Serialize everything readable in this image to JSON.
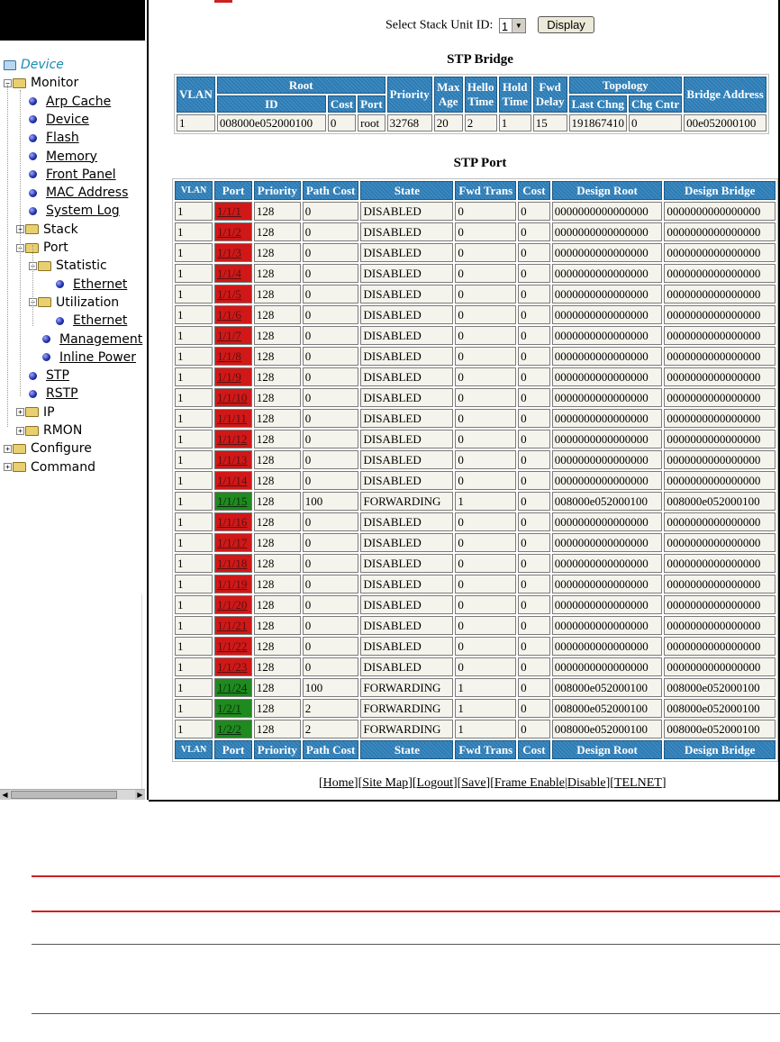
{
  "nav": {
    "tree": [
      {
        "label": "Device",
        "kind": "root"
      },
      {
        "label": "Monitor",
        "kind": "folder-open"
      },
      {
        "label": "Arp Cache",
        "kind": "link"
      },
      {
        "label": "Device",
        "kind": "link"
      },
      {
        "label": "Flash",
        "kind": "link"
      },
      {
        "label": "Memory",
        "kind": "link"
      },
      {
        "label": "Front Panel",
        "kind": "link"
      },
      {
        "label": "MAC Address",
        "kind": "link"
      },
      {
        "label": "System Log",
        "kind": "link"
      },
      {
        "label": "Stack",
        "kind": "folder-closed"
      },
      {
        "label": "Port",
        "kind": "folder-open"
      },
      {
        "label": "Statistic",
        "kind": "folder-open"
      },
      {
        "label": "Ethernet",
        "kind": "link"
      },
      {
        "label": "Utilization",
        "kind": "folder-open"
      },
      {
        "label": "Ethernet",
        "kind": "link"
      },
      {
        "label": "Management",
        "kind": "link"
      },
      {
        "label": "Inline Power",
        "kind": "link"
      },
      {
        "label": "STP",
        "kind": "link"
      },
      {
        "label": "RSTP",
        "kind": "link"
      },
      {
        "label": "IP",
        "kind": "folder-closed"
      },
      {
        "label": "RMON",
        "kind": "folder-closed"
      },
      {
        "label": "Configure",
        "kind": "folder-closed"
      },
      {
        "label": "Command",
        "kind": "folder-closed"
      }
    ]
  },
  "stack_select": {
    "label": "Select Stack Unit ID:",
    "value": "1",
    "button": "Display"
  },
  "stp_bridge": {
    "title": "STP Bridge",
    "group_headers": {
      "root": "Root",
      "topology": "Topology"
    },
    "headers": {
      "vlan": "VLAN",
      "id": "ID",
      "cost": "Cost",
      "port": "Port",
      "priority": "Priority",
      "max_age": "Max Age",
      "hello_time": "Hello Time",
      "hold_time": "Hold Time",
      "fwd_delay": "Fwd Delay",
      "last_chng": "Last Chng",
      "chg_cntr": "Chg Cntr",
      "bridge_address": "Bridge Address"
    },
    "row": {
      "vlan": "1",
      "id": "008000e052000100",
      "cost": "0",
      "port": "root",
      "priority": "32768",
      "max_age": "20",
      "hello_time": "2",
      "hold_time": "1",
      "fwd_delay": "15",
      "last_chng": "191867410",
      "chg_cntr": "0",
      "bridge_address": "00e052000100"
    }
  },
  "stp_port": {
    "title": "STP Port",
    "headers": [
      "VLAN",
      "Port",
      "Priority",
      "Path Cost",
      "State",
      "Fwd Trans",
      "Cost",
      "Design Root",
      "Design Bridge"
    ],
    "rows": [
      {
        "vlan": "1",
        "port": "1/1/1",
        "priority": "128",
        "path_cost": "0",
        "state": "DISABLED",
        "fwd_trans": "0",
        "cost": "0",
        "design_root": "0000000000000000",
        "design_bridge": "0000000000000000",
        "status": "red"
      },
      {
        "vlan": "1",
        "port": "1/1/2",
        "priority": "128",
        "path_cost": "0",
        "state": "DISABLED",
        "fwd_trans": "0",
        "cost": "0",
        "design_root": "0000000000000000",
        "design_bridge": "0000000000000000",
        "status": "red"
      },
      {
        "vlan": "1",
        "port": "1/1/3",
        "priority": "128",
        "path_cost": "0",
        "state": "DISABLED",
        "fwd_trans": "0",
        "cost": "0",
        "design_root": "0000000000000000",
        "design_bridge": "0000000000000000",
        "status": "red"
      },
      {
        "vlan": "1",
        "port": "1/1/4",
        "priority": "128",
        "path_cost": "0",
        "state": "DISABLED",
        "fwd_trans": "0",
        "cost": "0",
        "design_root": "0000000000000000",
        "design_bridge": "0000000000000000",
        "status": "red"
      },
      {
        "vlan": "1",
        "port": "1/1/5",
        "priority": "128",
        "path_cost": "0",
        "state": "DISABLED",
        "fwd_trans": "0",
        "cost": "0",
        "design_root": "0000000000000000",
        "design_bridge": "0000000000000000",
        "status": "red"
      },
      {
        "vlan": "1",
        "port": "1/1/6",
        "priority": "128",
        "path_cost": "0",
        "state": "DISABLED",
        "fwd_trans": "0",
        "cost": "0",
        "design_root": "0000000000000000",
        "design_bridge": "0000000000000000",
        "status": "red"
      },
      {
        "vlan": "1",
        "port": "1/1/7",
        "priority": "128",
        "path_cost": "0",
        "state": "DISABLED",
        "fwd_trans": "0",
        "cost": "0",
        "design_root": "0000000000000000",
        "design_bridge": "0000000000000000",
        "status": "red"
      },
      {
        "vlan": "1",
        "port": "1/1/8",
        "priority": "128",
        "path_cost": "0",
        "state": "DISABLED",
        "fwd_trans": "0",
        "cost": "0",
        "design_root": "0000000000000000",
        "design_bridge": "0000000000000000",
        "status": "red"
      },
      {
        "vlan": "1",
        "port": "1/1/9",
        "priority": "128",
        "path_cost": "0",
        "state": "DISABLED",
        "fwd_trans": "0",
        "cost": "0",
        "design_root": "0000000000000000",
        "design_bridge": "0000000000000000",
        "status": "red"
      },
      {
        "vlan": "1",
        "port": "1/1/10",
        "priority": "128",
        "path_cost": "0",
        "state": "DISABLED",
        "fwd_trans": "0",
        "cost": "0",
        "design_root": "0000000000000000",
        "design_bridge": "0000000000000000",
        "status": "red"
      },
      {
        "vlan": "1",
        "port": "1/1/11",
        "priority": "128",
        "path_cost": "0",
        "state": "DISABLED",
        "fwd_trans": "0",
        "cost": "0",
        "design_root": "0000000000000000",
        "design_bridge": "0000000000000000",
        "status": "red"
      },
      {
        "vlan": "1",
        "port": "1/1/12",
        "priority": "128",
        "path_cost": "0",
        "state": "DISABLED",
        "fwd_trans": "0",
        "cost": "0",
        "design_root": "0000000000000000",
        "design_bridge": "0000000000000000",
        "status": "red"
      },
      {
        "vlan": "1",
        "port": "1/1/13",
        "priority": "128",
        "path_cost": "0",
        "state": "DISABLED",
        "fwd_trans": "0",
        "cost": "0",
        "design_root": "0000000000000000",
        "design_bridge": "0000000000000000",
        "status": "red"
      },
      {
        "vlan": "1",
        "port": "1/1/14",
        "priority": "128",
        "path_cost": "0",
        "state": "DISABLED",
        "fwd_trans": "0",
        "cost": "0",
        "design_root": "0000000000000000",
        "design_bridge": "0000000000000000",
        "status": "red"
      },
      {
        "vlan": "1",
        "port": "1/1/15",
        "priority": "128",
        "path_cost": "100",
        "state": "FORWARDING",
        "fwd_trans": "1",
        "cost": "0",
        "design_root": "008000e052000100",
        "design_bridge": "008000e052000100",
        "status": "green"
      },
      {
        "vlan": "1",
        "port": "1/1/16",
        "priority": "128",
        "path_cost": "0",
        "state": "DISABLED",
        "fwd_trans": "0",
        "cost": "0",
        "design_root": "0000000000000000",
        "design_bridge": "0000000000000000",
        "status": "red"
      },
      {
        "vlan": "1",
        "port": "1/1/17",
        "priority": "128",
        "path_cost": "0",
        "state": "DISABLED",
        "fwd_trans": "0",
        "cost": "0",
        "design_root": "0000000000000000",
        "design_bridge": "0000000000000000",
        "status": "red"
      },
      {
        "vlan": "1",
        "port": "1/1/18",
        "priority": "128",
        "path_cost": "0",
        "state": "DISABLED",
        "fwd_trans": "0",
        "cost": "0",
        "design_root": "0000000000000000",
        "design_bridge": "0000000000000000",
        "status": "red"
      },
      {
        "vlan": "1",
        "port": "1/1/19",
        "priority": "128",
        "path_cost": "0",
        "state": "DISABLED",
        "fwd_trans": "0",
        "cost": "0",
        "design_root": "0000000000000000",
        "design_bridge": "0000000000000000",
        "status": "red"
      },
      {
        "vlan": "1",
        "port": "1/1/20",
        "priority": "128",
        "path_cost": "0",
        "state": "DISABLED",
        "fwd_trans": "0",
        "cost": "0",
        "design_root": "0000000000000000",
        "design_bridge": "0000000000000000",
        "status": "red"
      },
      {
        "vlan": "1",
        "port": "1/1/21",
        "priority": "128",
        "path_cost": "0",
        "state": "DISABLED",
        "fwd_trans": "0",
        "cost": "0",
        "design_root": "0000000000000000",
        "design_bridge": "0000000000000000",
        "status": "red"
      },
      {
        "vlan": "1",
        "port": "1/1/22",
        "priority": "128",
        "path_cost": "0",
        "state": "DISABLED",
        "fwd_trans": "0",
        "cost": "0",
        "design_root": "0000000000000000",
        "design_bridge": "0000000000000000",
        "status": "red"
      },
      {
        "vlan": "1",
        "port": "1/1/23",
        "priority": "128",
        "path_cost": "0",
        "state": "DISABLED",
        "fwd_trans": "0",
        "cost": "0",
        "design_root": "0000000000000000",
        "design_bridge": "0000000000000000",
        "status": "red"
      },
      {
        "vlan": "1",
        "port": "1/1/24",
        "priority": "128",
        "path_cost": "100",
        "state": "FORWARDING",
        "fwd_trans": "1",
        "cost": "0",
        "design_root": "008000e052000100",
        "design_bridge": "008000e052000100",
        "status": "green"
      },
      {
        "vlan": "1",
        "port": "1/2/1",
        "priority": "128",
        "path_cost": "2",
        "state": "FORWARDING",
        "fwd_trans": "1",
        "cost": "0",
        "design_root": "008000e052000100",
        "design_bridge": "008000e052000100",
        "status": "green"
      },
      {
        "vlan": "1",
        "port": "1/2/2",
        "priority": "128",
        "path_cost": "2",
        "state": "FORWARDING",
        "fwd_trans": "1",
        "cost": "0",
        "design_root": "008000e052000100",
        "design_bridge": "008000e052000100",
        "status": "green"
      }
    ]
  },
  "footer_links": [
    "Home",
    "Site Map",
    "Logout",
    "Save",
    "Frame Enable",
    "Disable",
    "TELNET"
  ],
  "colors": {
    "header_blue": "#2c7cb6",
    "port_disabled": "#d01818",
    "port_forwarding": "#1f8a1f",
    "doc_rule_red": "#cc2222"
  }
}
